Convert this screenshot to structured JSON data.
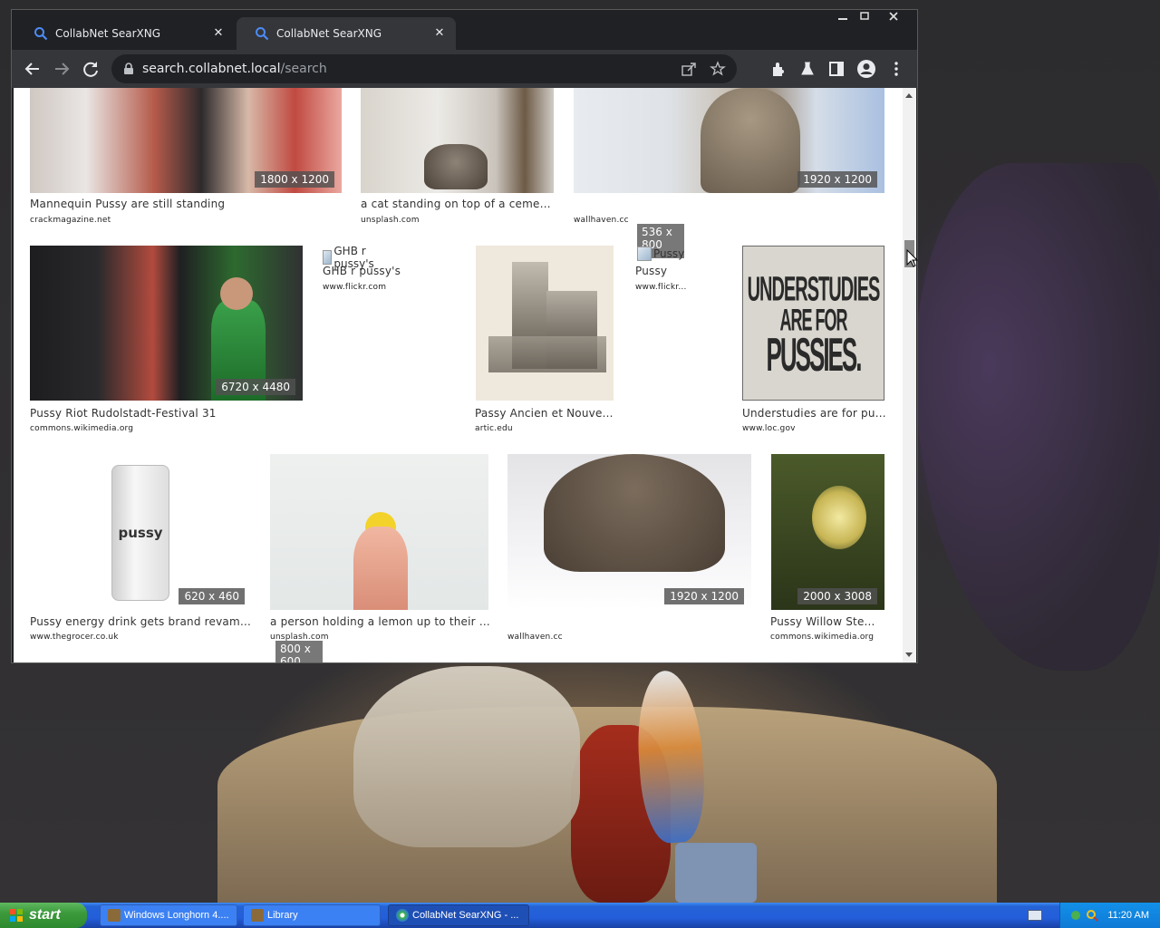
{
  "browser": {
    "tabs": [
      {
        "title": "CollabNet SearXNG",
        "close": "✕"
      },
      {
        "title": "CollabNet SearXNG",
        "close": "✕"
      }
    ],
    "window_controls": {
      "minimize": "—",
      "maximize": "▢",
      "close": "✕"
    },
    "url_host": "search.collabnet.local",
    "url_path": "/search"
  },
  "results": [
    {
      "caption": "Mannequin Pussy are still standing",
      "source": "crackmagazine.net",
      "resolution": "1800 x 1200"
    },
    {
      "caption": "a cat standing on top of a cement ...",
      "source": "unsplash.com",
      "resolution": ""
    },
    {
      "caption": "",
      "source": "wallhaven.cc",
      "resolution": "1920 x 1200"
    },
    {
      "caption": "Pussy Riot Rudolstadt-Festival 31",
      "source": "commons.wikimedia.org",
      "resolution": "6720 x 4480"
    },
    {
      "caption": "GHB r pussy's",
      "source": "www.flickr.com",
      "alt": "GHB r pussy's"
    },
    {
      "caption": "Passy Ancien et Nouvea...",
      "source": "artic.edu",
      "resolution": ""
    },
    {
      "caption": "Pussy",
      "source": "www.flickr...",
      "alt": "Pussy",
      "resolution_line1": "536 x",
      "resolution_line2": "800"
    },
    {
      "caption": "Understudies are for pus...",
      "source": "www.loc.gov",
      "poster_line1": "UNDERSTUDIES",
      "poster_line2": "ARE FOR",
      "poster_line3": "PUSSIES."
    },
    {
      "caption": "Pussy energy drink gets brand revamp |...",
      "source": "www.thegrocer.co.uk",
      "resolution": "620 x 460",
      "can_text": "pussy"
    },
    {
      "caption": "a person holding a lemon up to their face",
      "source": "unsplash.com",
      "resolution_line1": "800 x",
      "resolution_line2": "600"
    },
    {
      "caption": "",
      "source": "wallhaven.cc",
      "resolution": "1920 x 1200"
    },
    {
      "caption": "Pussy Willow Ste...",
      "source": "commons.wikimedia.org",
      "resolution": "2000 x 3008"
    }
  ],
  "taskbar": {
    "start_label": "start",
    "tasks": [
      {
        "label": "Windows Longhorn 4...."
      },
      {
        "label": "Library"
      },
      {
        "label": "CollabNet SearXNG - ..."
      }
    ],
    "clock": "11:20 AM"
  }
}
